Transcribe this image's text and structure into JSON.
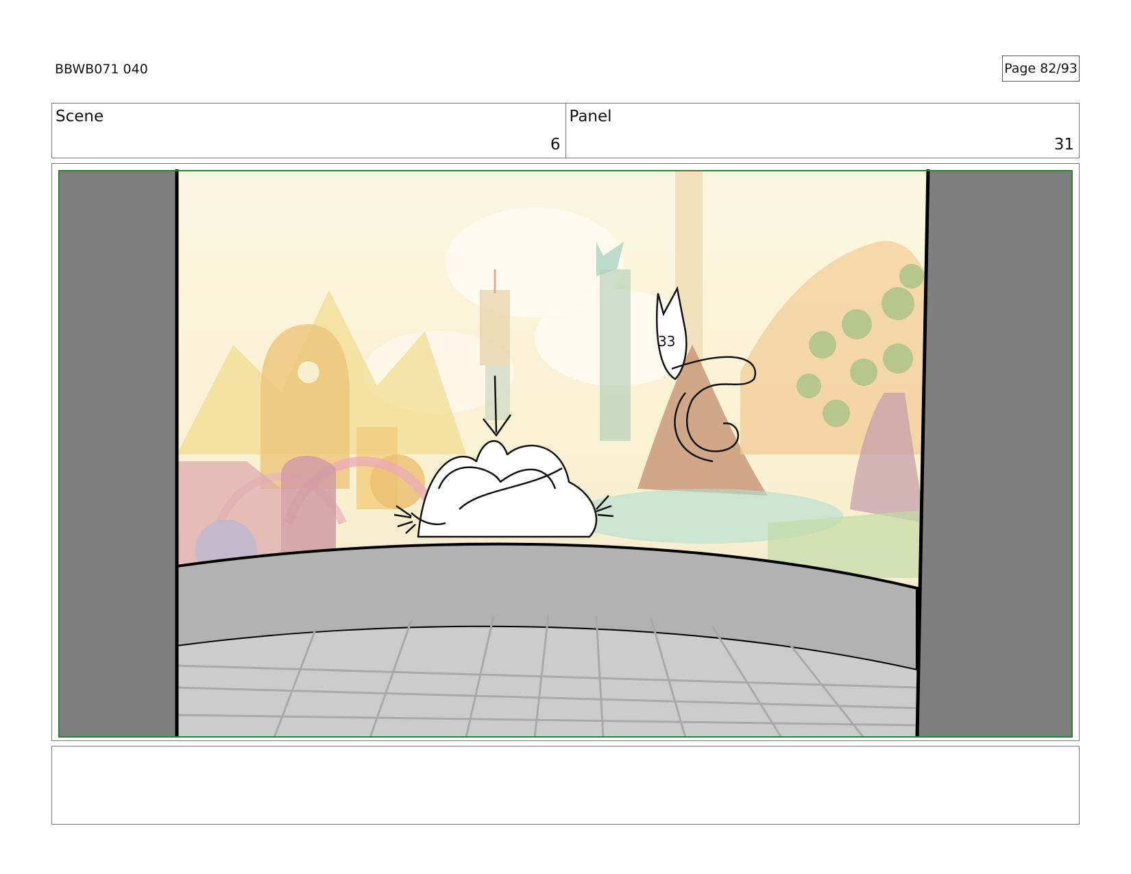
{
  "header": {
    "document_id": "BBWB071 040",
    "page_label": "Page 82/93"
  },
  "scene": {
    "label": "Scene",
    "value": "6"
  },
  "panel": {
    "label": "Panel",
    "value": "31"
  },
  "drawing": {
    "sketch_numbers": "33"
  },
  "notes": {
    "text": ""
  },
  "colors": {
    "safe_frame": "#2e7d32",
    "letterbox": "#7f7f7f",
    "wall": "#b2b2b2",
    "floor": "#cccccc",
    "sky": "#fbf5d8"
  }
}
